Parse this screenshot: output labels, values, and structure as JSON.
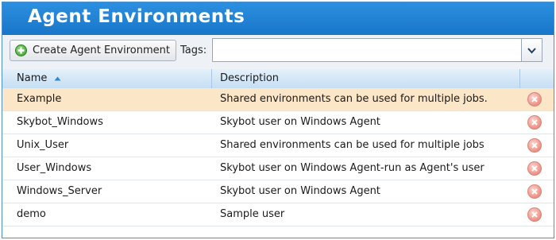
{
  "title": "Agent Environments",
  "toolbar": {
    "create_label": "Create Agent Environment",
    "tags_label": "Tags:",
    "tags_value": ""
  },
  "columns": {
    "name": "Name",
    "description": "Description"
  },
  "rows": [
    {
      "name": "Example",
      "description": "Shared environments can be used for multiple jobs.",
      "selected": true
    },
    {
      "name": "Skybot_Windows",
      "description": "Skybot user on Windows Agent"
    },
    {
      "name": "Unix_User",
      "description": "Shared environments can be used for multiple jobs"
    },
    {
      "name": "User_Windows",
      "description": "Skybot user on Windows Agent-run as Agent's user"
    },
    {
      "name": "Windows_Server",
      "description": "Skybot user on Windows Agent"
    },
    {
      "name": "demo",
      "description": "Sample user"
    }
  ],
  "colors": {
    "title_bar": "#1f82d4",
    "selected_row": "#fbe6c8",
    "delete_icon": "#f09a8e"
  },
  "icons": {
    "create": "plus-circle-icon",
    "delete": "delete-x-icon",
    "sort": "sort-ascending-icon",
    "dropdown": "chevron-down-icon"
  }
}
